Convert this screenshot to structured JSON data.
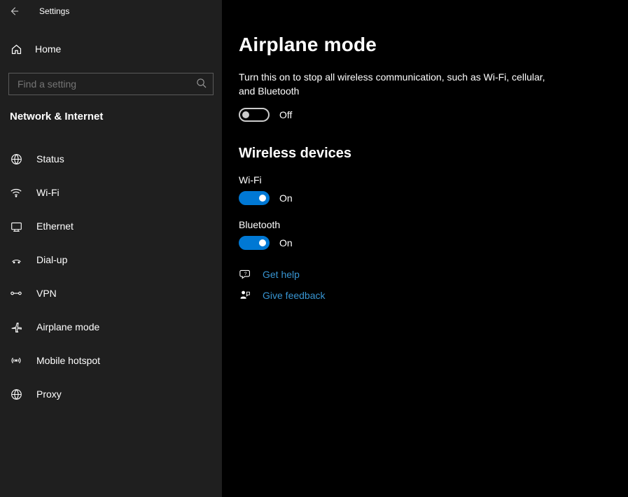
{
  "window": {
    "title": "Settings"
  },
  "sidebar": {
    "home_label": "Home",
    "search_placeholder": "Find a setting",
    "section_label": "Network & Internet",
    "items": [
      {
        "label": "Status"
      },
      {
        "label": "Wi-Fi"
      },
      {
        "label": "Ethernet"
      },
      {
        "label": "Dial-up"
      },
      {
        "label": "VPN"
      },
      {
        "label": "Airplane mode"
      },
      {
        "label": "Mobile hotspot"
      },
      {
        "label": "Proxy"
      }
    ]
  },
  "main": {
    "title": "Airplane mode",
    "description": "Turn this on to stop all wireless communication, such as Wi-Fi, cellular, and Bluetooth",
    "airplane_toggle_state": "Off",
    "wireless_heading": "Wireless devices",
    "devices": {
      "wifi_label": "Wi-Fi",
      "wifi_state": "On",
      "bt_label": "Bluetooth",
      "bt_state": "On"
    },
    "links": {
      "help": "Get help",
      "feedback": "Give feedback"
    }
  }
}
